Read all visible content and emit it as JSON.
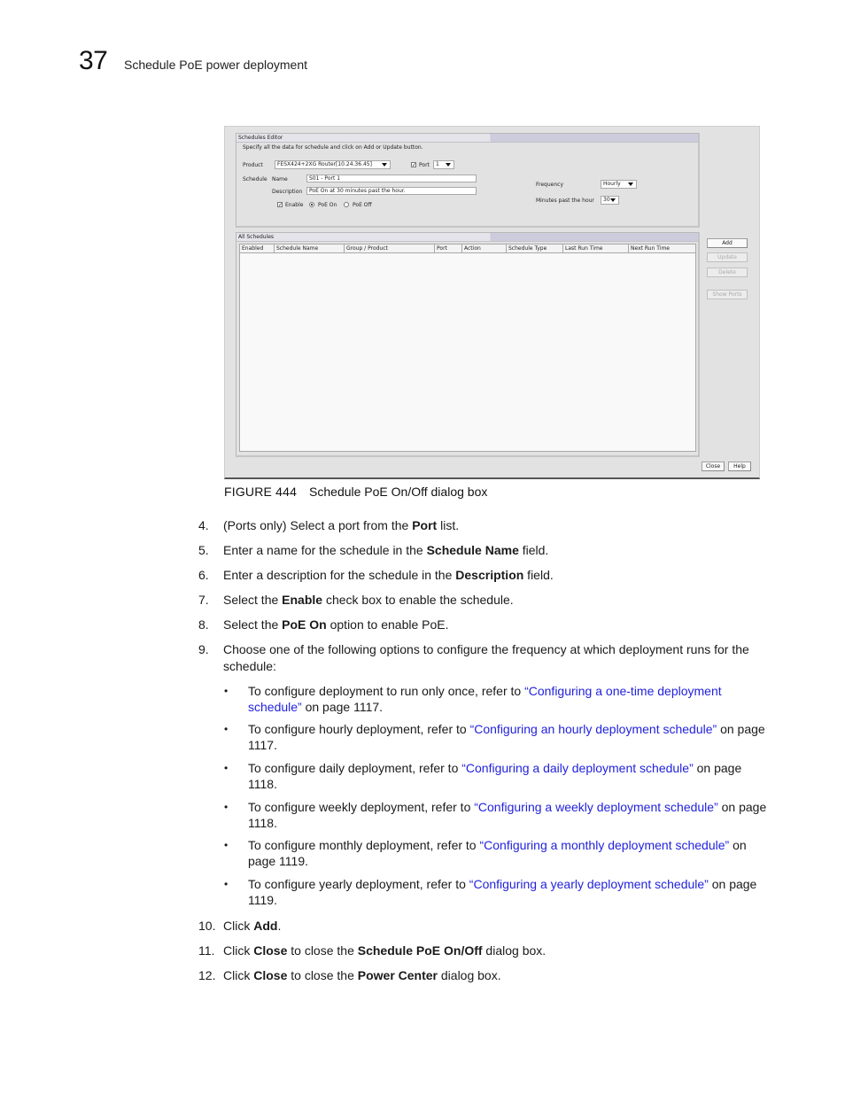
{
  "header": {
    "chapter_number": "37",
    "chapter_title": "Schedule PoE power deployment"
  },
  "dialog": {
    "editor": {
      "title": "Schedules Editor",
      "instruction": "Specify all the data for schedule and click on Add or Update button.",
      "product_label": "Product",
      "product_value": "FESX424+2XG Router[10.24.36.45]",
      "port_checkbox_label": "Port",
      "port_checked": true,
      "port_value": "1",
      "schedule_label": "Schedule",
      "name_label": "Name",
      "name_value": "S01 - Port 1",
      "description_label": "Description",
      "description_value": "PoE On at 30 minutes past the hour.",
      "enable_label": "Enable",
      "enable_checked": true,
      "poe_on_label": "PoE On",
      "poe_off_label": "PoE Off",
      "poe_selected": "PoE On",
      "frequency_label": "Frequency",
      "frequency_value": "Hourly",
      "minutes_label": "Minutes past the hour",
      "minutes_value": "30"
    },
    "all_schedules": {
      "title": "All Schedules",
      "columns": [
        "Enabled",
        "Schedule Name",
        "Group / Product",
        "Port",
        "Action",
        "Schedule Type",
        "Last Run Time",
        "Next Run Time"
      ],
      "rows": []
    },
    "buttons": {
      "add": "Add",
      "update": "Update",
      "delete": "Delete",
      "show_ports": "Show Ports",
      "close": "Close",
      "help": "Help"
    }
  },
  "figure": {
    "label": "FIGURE 444",
    "caption": "Schedule PoE On/Off dialog box"
  },
  "steps": [
    {
      "num": "4.",
      "parts": [
        "(Ports only) Select a port from the ",
        "Port",
        " list."
      ]
    },
    {
      "num": "5.",
      "parts": [
        "Enter a name for the schedule in the ",
        "Schedule Name",
        " field."
      ]
    },
    {
      "num": "6.",
      "parts": [
        "Enter a description for the schedule in the ",
        "Description",
        " field."
      ]
    },
    {
      "num": "7.",
      "parts": [
        "Select the ",
        "Enable",
        " check box to enable the schedule."
      ]
    },
    {
      "num": "8.",
      "parts": [
        "Select the ",
        "PoE On",
        " option to enable PoE."
      ]
    },
    {
      "num": "9.",
      "text": "Choose one of the following options to configure the frequency at which deployment runs for the schedule:"
    }
  ],
  "bullets": [
    {
      "pre": "To configure deployment to run only once, refer to ",
      "link": "“Configuring a one-time deployment schedule”",
      "post": " on page 1117."
    },
    {
      "pre": "To configure hourly deployment, refer to ",
      "link": "“Configuring an hourly deployment schedule”",
      "post": " on page 1117."
    },
    {
      "pre": "To configure daily deployment, refer to ",
      "link": "“Configuring a daily deployment schedule”",
      "post": " on page 1118."
    },
    {
      "pre": "To configure weekly deployment, refer to ",
      "link": "“Configuring a weekly deployment schedule”",
      "post": " on page 1118."
    },
    {
      "pre": "To configure monthly deployment, refer to ",
      "link": "“Configuring a monthly deployment schedule”",
      "post": " on page 1119."
    },
    {
      "pre": "To configure yearly deployment, refer to ",
      "link": "“Configuring a yearly deployment schedule”",
      "post": " on page 1119."
    }
  ],
  "final_steps": [
    {
      "num": "10.",
      "parts": [
        "Click ",
        "Add",
        "."
      ]
    },
    {
      "num": "11.",
      "parts": [
        "Click ",
        "Close",
        " to close the ",
        "Schedule PoE On/Off",
        " dialog box."
      ]
    },
    {
      "num": "12.",
      "parts": [
        "Click ",
        "Close",
        " to close the ",
        "Power Center",
        " dialog box."
      ]
    }
  ],
  "colors": {
    "link": "#2222dd",
    "dialog_bg": "#e2e2e2",
    "panel_header": "#ccccdc"
  }
}
